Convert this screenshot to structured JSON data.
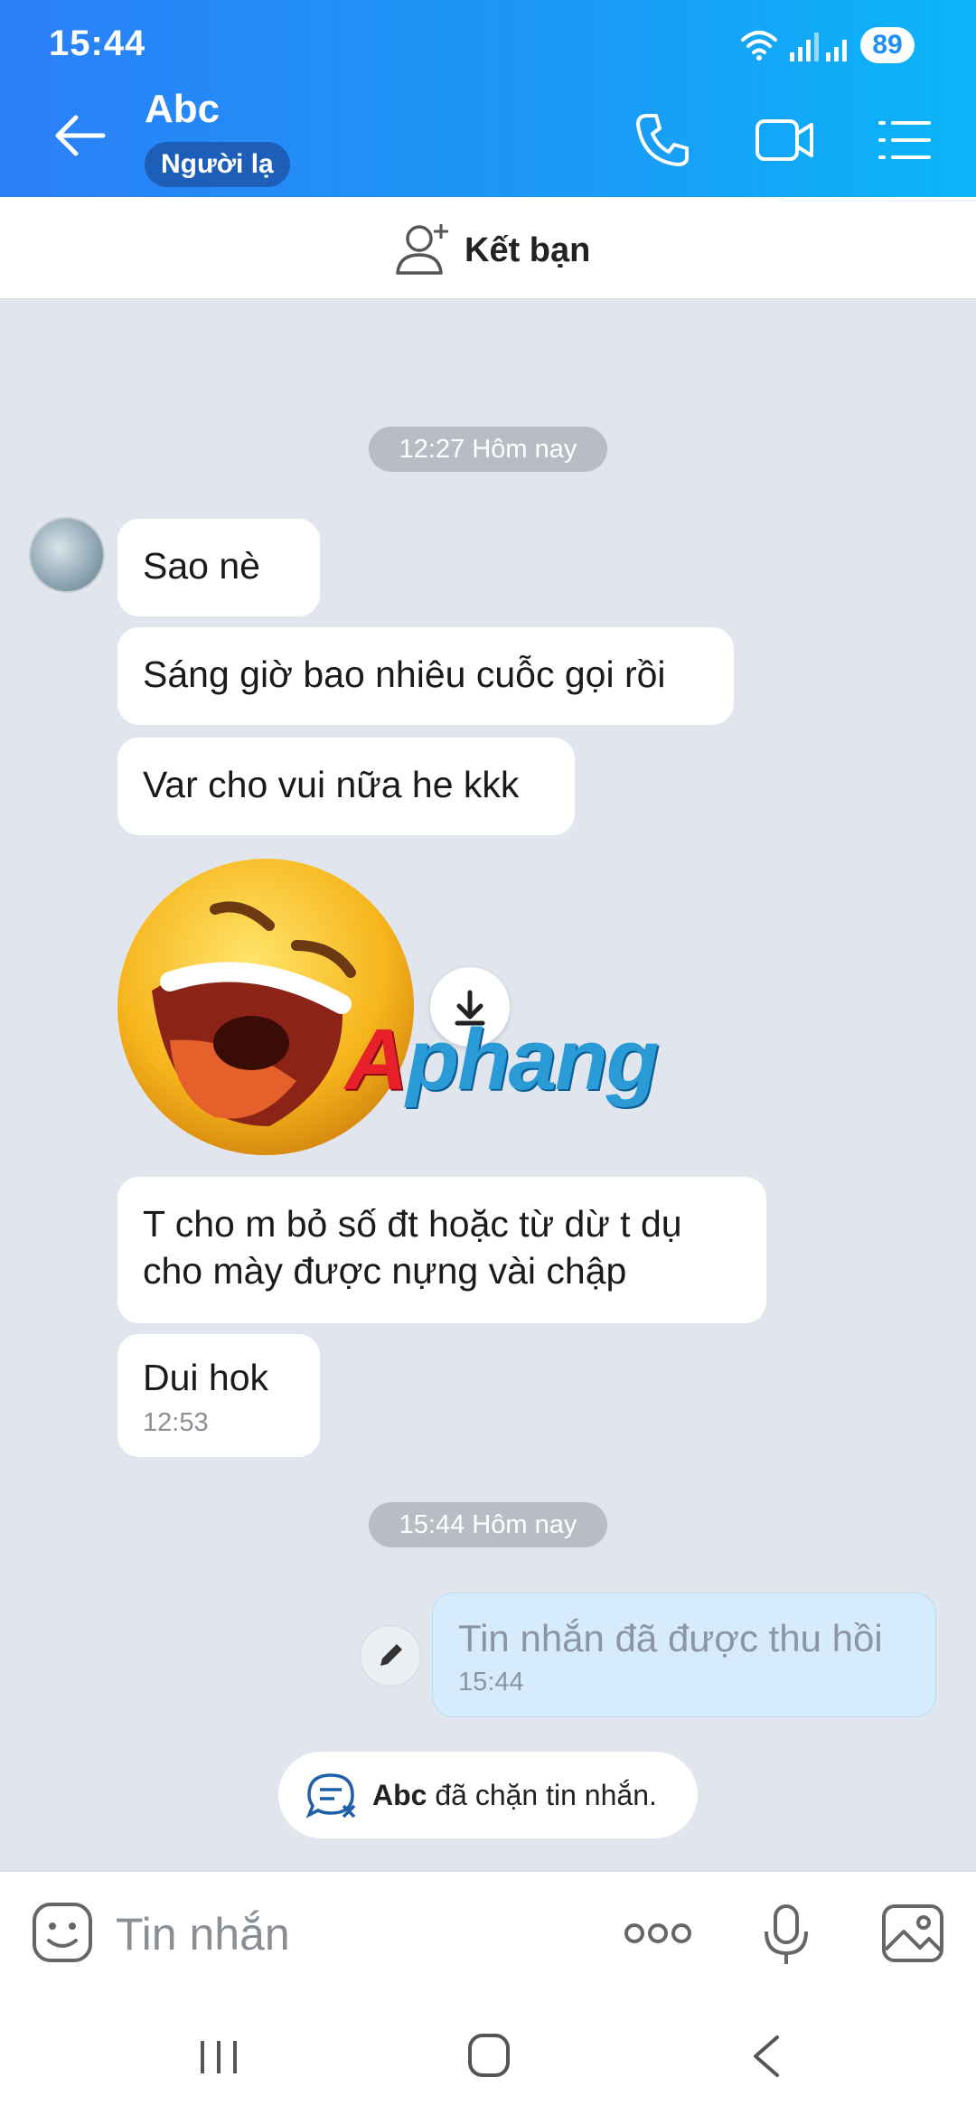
{
  "status_bar": {
    "time": "15:44",
    "battery": "89"
  },
  "header": {
    "contact_name": "Abc",
    "badge": "Người lạ"
  },
  "add_friend": {
    "label": "Kết bạn"
  },
  "chat": {
    "timestamp_1": "12:27 Hôm nay",
    "messages": [
      {
        "text": "Sao nè"
      },
      {
        "text": "Sáng giờ bao nhiêu cuỗc gọi rồi"
      },
      {
        "text": "Var cho vui nữa he kkk"
      },
      {
        "text": "T cho m bỏ số đt hoặc từ dừ t dụ cho mày được nựng vài chập"
      },
      {
        "text": "Dui hok",
        "time": "12:53"
      }
    ],
    "timestamp_2": "15:44 Hôm nay",
    "recalled": {
      "text": "Tin nhắn đã được thu hồi",
      "time": "15:44"
    },
    "blocked": {
      "name": "Abc",
      "text": " đã chặn tin nhắn."
    }
  },
  "watermark": {
    "first": "A",
    "rest": "phang"
  },
  "input": {
    "placeholder": "Tin nhắn"
  }
}
